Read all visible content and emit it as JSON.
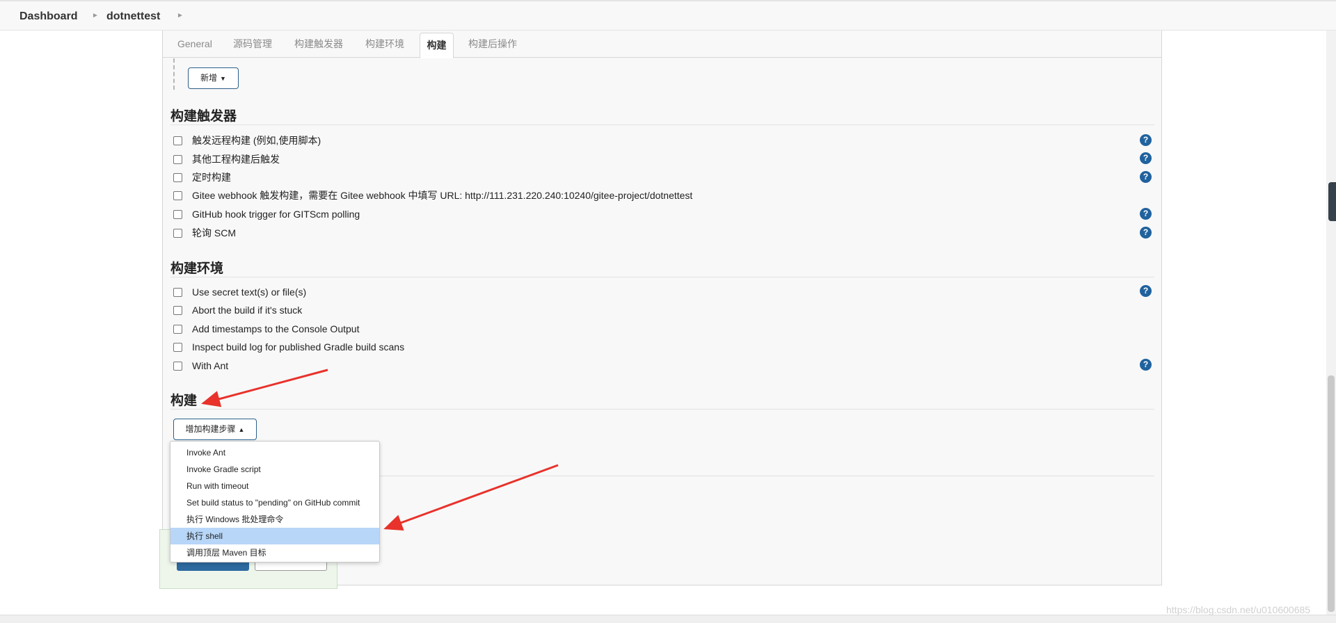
{
  "breadcrumb": {
    "items": [
      "Dashboard",
      "dotnettest"
    ]
  },
  "tabs": [
    {
      "label": "General"
    },
    {
      "label": "源码管理"
    },
    {
      "label": "构建触发器"
    },
    {
      "label": "构建环境"
    },
    {
      "label": "构建",
      "active": true
    },
    {
      "label": "构建后操作"
    }
  ],
  "add_button": {
    "label": "新增"
  },
  "triggers": {
    "title": "构建触发器",
    "items": [
      {
        "label": "触发远程构建 (例如,使用脚本)",
        "checked": false,
        "help": true
      },
      {
        "label": "其他工程构建后触发",
        "checked": false,
        "help": true
      },
      {
        "label": "定时构建",
        "checked": false,
        "help": true
      },
      {
        "label": "Gitee webhook 触发构建，需要在 Gitee webhook 中填写 URL: http://111.231.220.240:10240/gitee-project/dotnettest",
        "checked": false,
        "help": false
      },
      {
        "label": "GitHub hook trigger for GITScm polling",
        "checked": false,
        "help": true
      },
      {
        "label": "轮询 SCM",
        "checked": false,
        "help": true
      }
    ]
  },
  "environment": {
    "title": "构建环境",
    "items": [
      {
        "label": "Use secret text(s) or file(s)",
        "checked": false,
        "help": true
      },
      {
        "label": "Abort the build if it's stuck",
        "checked": false,
        "help": false
      },
      {
        "label": "Add timestamps to the Console Output",
        "checked": false,
        "help": false
      },
      {
        "label": "Inspect build log for published Gradle build scans",
        "checked": false,
        "help": false
      },
      {
        "label": "With Ant",
        "checked": false,
        "help": true
      }
    ]
  },
  "build": {
    "title": "构建",
    "add_step_label": "增加构建步骤",
    "menu_items": [
      {
        "label": "Invoke Ant"
      },
      {
        "label": "Invoke Gradle script"
      },
      {
        "label": "Run with timeout"
      },
      {
        "label": "Set build status to \"pending\" on GitHub commit"
      },
      {
        "label": "执行 Windows 批处理命令"
      },
      {
        "label": "执行 shell",
        "highlighted": true
      },
      {
        "label": "调用顶层 Maven 目标"
      }
    ]
  },
  "help_glyph": "?",
  "watermark": "https://blog.csdn.net/u010600685",
  "colors": {
    "help_icon": "#20629e",
    "menu_highlight": "#b7d6f8",
    "annotation_arrow": "#e8322b"
  }
}
